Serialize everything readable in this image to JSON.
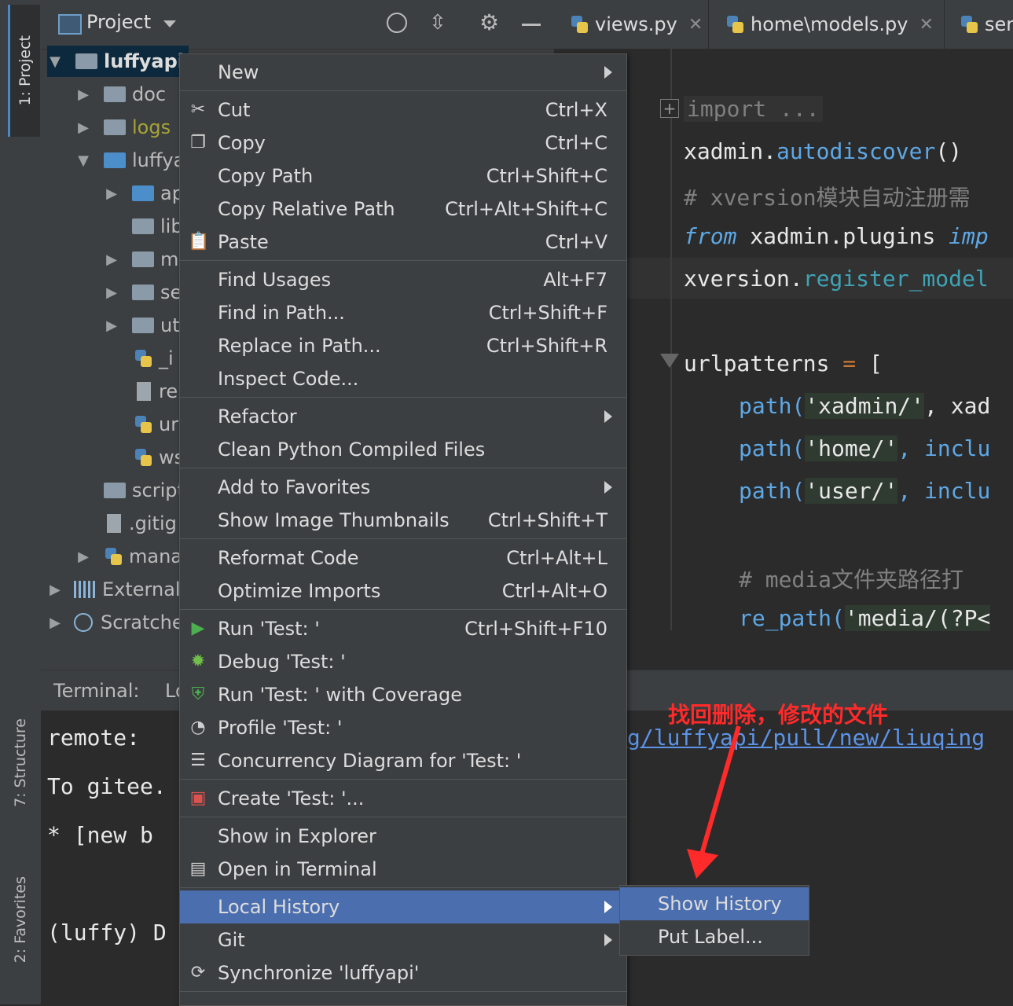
{
  "left_strip": {
    "project_tab": "1: Project",
    "structure_tab": "7: Structure",
    "favorites_tab": "2: Favorites"
  },
  "project_panel": {
    "title": "Project",
    "tree": [
      {
        "label": "luffyapi"
      },
      {
        "label": "doc"
      },
      {
        "label": "logs"
      },
      {
        "label": "luffya"
      },
      {
        "label": "ap"
      },
      {
        "label": "lib"
      },
      {
        "label": "m"
      },
      {
        "label": "se"
      },
      {
        "label": "ut"
      },
      {
        "label": "_i"
      },
      {
        "label": "re"
      },
      {
        "label": "ur"
      },
      {
        "label": "ws"
      },
      {
        "label": "script"
      },
      {
        "label": ".gitig"
      },
      {
        "label": "mana"
      },
      {
        "label": "External"
      },
      {
        "label": "Scratche"
      }
    ]
  },
  "editor_tabs": [
    {
      "label": "views.py"
    },
    {
      "label": "home\\models.py"
    },
    {
      "label": "ser"
    }
  ],
  "editor": {
    "import_fold": "import ...",
    "l1a": "xadmin.",
    "l1b": "autodiscover",
    "l1c": "()",
    "l2": "# xversion模块自动注册需",
    "l3a": "from",
    "l3b": " xadmin.plugins ",
    "l3c": "imp",
    "l4a": "xversion.",
    "l4b": "register_model",
    "l5a": "urlpatterns ",
    "l5b": "=",
    "l5c": " [",
    "l6a": "path(",
    "l6b": "'xadmin/'",
    "l6c": ",  xad",
    "l7a": "path(",
    "l7b": "'home/'",
    "l7c": ",  inclu",
    "l8a": "path(",
    "l8b": "'user/'",
    "l8c": ",  inclu",
    "l9": "# media文件夹路径打",
    "l10a": "re_path(",
    "l10b": "'media/(?P<"
  },
  "terminal": {
    "header_label": "Terminal:",
    "header_tab2": "Lo",
    "line1": "remote:",
    "line2": "To gitee.",
    "line3": " * [new b",
    "line4": "(luffy) D",
    "url": "g/luffyapi/pull/new/liuqing"
  },
  "context_menu": {
    "items": [
      {
        "label": "New",
        "shortcut": ""
      },
      {
        "label": "Cut",
        "shortcut": "Ctrl+X"
      },
      {
        "label": "Copy",
        "shortcut": "Ctrl+C"
      },
      {
        "label": "Copy Path",
        "shortcut": "Ctrl+Shift+C"
      },
      {
        "label": "Copy Relative Path",
        "shortcut": "Ctrl+Alt+Shift+C"
      },
      {
        "label": "Paste",
        "shortcut": "Ctrl+V"
      },
      {
        "label": "Find Usages",
        "shortcut": "Alt+F7"
      },
      {
        "label": "Find in Path...",
        "shortcut": "Ctrl+Shift+F"
      },
      {
        "label": "Replace in Path...",
        "shortcut": "Ctrl+Shift+R"
      },
      {
        "label": "Inspect Code...",
        "shortcut": ""
      },
      {
        "label": "Refactor",
        "shortcut": ""
      },
      {
        "label": "Clean Python Compiled Files",
        "shortcut": ""
      },
      {
        "label": "Add to Favorites",
        "shortcut": ""
      },
      {
        "label": "Show Image Thumbnails",
        "shortcut": "Ctrl+Shift+T"
      },
      {
        "label": "Reformat Code",
        "shortcut": "Ctrl+Alt+L"
      },
      {
        "label": "Optimize Imports",
        "shortcut": "Ctrl+Alt+O"
      },
      {
        "label": "Run 'Test: '",
        "shortcut": "Ctrl+Shift+F10"
      },
      {
        "label": "Debug 'Test: '",
        "shortcut": ""
      },
      {
        "label": "Run 'Test: ' with Coverage",
        "shortcut": ""
      },
      {
        "label": "Profile 'Test: '",
        "shortcut": ""
      },
      {
        "label": "Concurrency Diagram for 'Test: '",
        "shortcut": ""
      },
      {
        "label": "Create 'Test: '...",
        "shortcut": ""
      },
      {
        "label": "Show in Explorer",
        "shortcut": ""
      },
      {
        "label": "Open in Terminal",
        "shortcut": ""
      },
      {
        "label": "Local History",
        "shortcut": ""
      },
      {
        "label": "Git",
        "shortcut": ""
      },
      {
        "label": "Synchronize 'luffyapi'",
        "shortcut": ""
      }
    ]
  },
  "submenu": {
    "items": [
      {
        "label": "Show History"
      },
      {
        "label": "Put Label..."
      }
    ]
  },
  "annotation": "找回删除，修改的文件",
  "colors": {
    "selection": "#4b6eaf",
    "annotation": "#ff2a2a",
    "run_icon": "#4caf50"
  }
}
